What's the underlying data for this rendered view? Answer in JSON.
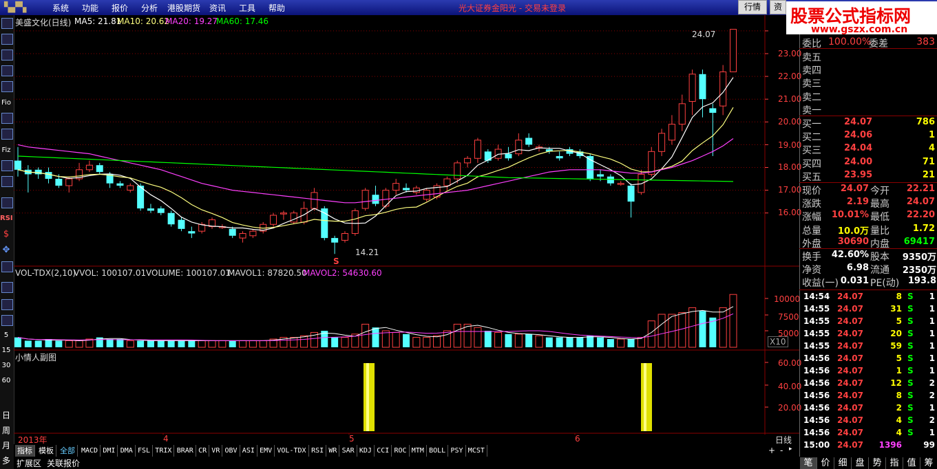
{
  "menubar": {
    "items": [
      "系统",
      "功能",
      "报价",
      "分析",
      "港股期货",
      "资讯",
      "工具",
      "帮助"
    ],
    "broker_status": "光大证券金阳光 - 交易未登录",
    "quote_button": "行情",
    "quote_button2": "资"
  },
  "watermark": {
    "line1": "股票公式指标网",
    "line2": "www.gszx.com.cn"
  },
  "left_toolbar": [
    "Fio",
    "Fiz",
    "RSI",
    "5",
    "15",
    "30",
    "60",
    "日",
    "周",
    "月",
    "多"
  ],
  "main_chart": {
    "title": "美盛文化(日线)",
    "ma5": "MA5: 21.81",
    "ma10": "MA10: 20.62",
    "ma20": "MA20: 19.27",
    "ma60": "MA60: 17.46",
    "high_label": "24.07",
    "low_label": "14.21",
    "s_marker": "S",
    "y_ticks": [
      "23.00",
      "22.00",
      "21.00",
      "20.00",
      "19.00",
      "18.00",
      "17.00",
      "16.00"
    ],
    "colors": {
      "up": "#ff4040",
      "down": "#54ffff",
      "ma5": "#ffffff",
      "ma10": "#ffff80",
      "ma20": "#ff40ff",
      "ma60": "#00ff00"
    }
  },
  "vol_chart": {
    "title": "VOL-TDX(2,10)",
    "vvol": "VVOL: 100107.01",
    "volume": "VOLUME: 100107.01",
    "mavol1": "MAVOL1: 87820.50",
    "mavol2": "MAVOL2: 54630.60",
    "y_ticks": [
      "10000",
      "7500",
      "5000"
    ],
    "unit": "X10"
  },
  "sub_chart": {
    "title": "小情人副图",
    "y_ticks": [
      "60.00",
      "40.00",
      "20.00"
    ]
  },
  "time_axis": {
    "labels": [
      "2013年",
      "4",
      "5",
      "6"
    ],
    "period": "日线"
  },
  "bottom_tabs": [
    "指标",
    "模板",
    "全部",
    "MACD",
    "DMI",
    "DMA",
    "FSL",
    "TRIX",
    "BRAR",
    "CR",
    "VR",
    "OBV",
    "ASI",
    "EMV",
    "VOL-TDX",
    "RSI",
    "WR",
    "SAR",
    "KDJ",
    "CCI",
    "ROC",
    "MTM",
    "BOLL",
    "PSY",
    "MCST"
  ],
  "status_tabs": [
    "扩展区",
    "关联报价"
  ],
  "scroll_controls": [
    "+",
    "-"
  ],
  "right_panel": {
    "top_row": [
      "委比",
      "100.00%",
      "委差",
      "383"
    ],
    "sell": [
      [
        "卖五",
        "",
        ""
      ],
      [
        "卖四",
        "",
        ""
      ],
      [
        "卖三",
        "",
        ""
      ],
      [
        "卖二",
        "",
        ""
      ],
      [
        "卖一",
        "",
        ""
      ]
    ],
    "buy": [
      [
        "买一",
        "24.07",
        "786"
      ],
      [
        "买二",
        "24.06",
        "1"
      ],
      [
        "买三",
        "24.04",
        "4"
      ],
      [
        "买四",
        "24.00",
        "71"
      ],
      [
        "买五",
        "23.95",
        "21"
      ]
    ],
    "stats1": [
      [
        "现价",
        "24.07",
        "今开",
        "22.21"
      ],
      [
        "涨跌",
        "2.19",
        "最高",
        "24.07"
      ],
      [
        "涨幅",
        "10.01%",
        "最低",
        "22.20"
      ],
      [
        "总量",
        "10.0万",
        "量比",
        "1.72"
      ],
      [
        "外盘",
        "30690",
        "内盘",
        "69417"
      ]
    ],
    "stats2": [
      [
        "换手",
        "42.60%",
        "股本",
        "9350万"
      ],
      [
        "净资",
        "6.98",
        "流通",
        "2350万"
      ],
      [
        "收益(一)",
        "0.031",
        "PE(动)",
        "193.8"
      ]
    ],
    "ticks": [
      [
        "14:54",
        "24.07",
        "8",
        "S",
        "1"
      ],
      [
        "14:55",
        "24.07",
        "31",
        "S",
        "1"
      ],
      [
        "14:55",
        "24.07",
        "5",
        "S",
        "1"
      ],
      [
        "14:55",
        "24.07",
        "20",
        "S",
        "1"
      ],
      [
        "14:55",
        "24.07",
        "59",
        "S",
        "1"
      ],
      [
        "14:56",
        "24.07",
        "5",
        "S",
        "1"
      ],
      [
        "14:56",
        "24.07",
        "1",
        "S",
        "1"
      ],
      [
        "14:56",
        "24.07",
        "12",
        "S",
        "2"
      ],
      [
        "14:56",
        "24.07",
        "8",
        "S",
        "2"
      ],
      [
        "14:56",
        "24.07",
        "2",
        "S",
        "1"
      ],
      [
        "14:56",
        "24.07",
        "4",
        "S",
        "2"
      ],
      [
        "14:56",
        "24.07",
        "4",
        "S",
        "1"
      ],
      [
        "15:00",
        "24.07",
        "1396",
        "",
        "99"
      ]
    ],
    "tabs": [
      "笔",
      "价",
      "细",
      "盘",
      "势",
      "指",
      "值",
      "筹"
    ]
  }
}
